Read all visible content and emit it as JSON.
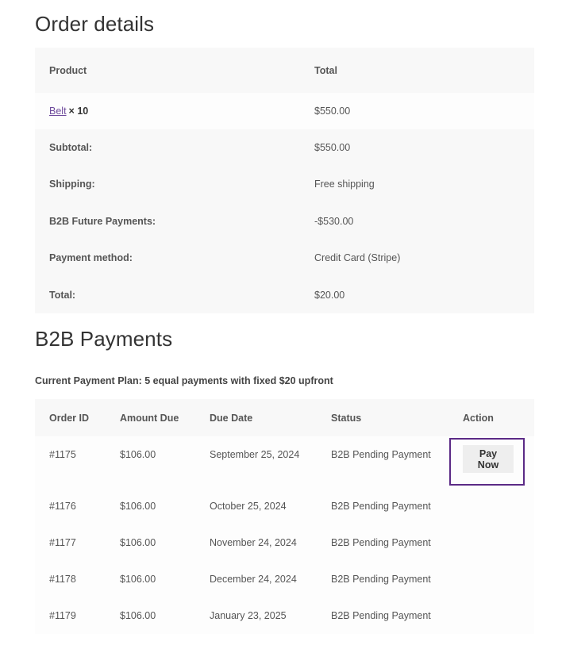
{
  "order_details": {
    "title": "Order details",
    "headers": {
      "product": "Product",
      "total": "Total"
    },
    "product_row": {
      "name": "Belt",
      "qty": "× 10",
      "total": "$550.00"
    },
    "rows": [
      {
        "label": "Subtotal:",
        "value": "$550.00"
      },
      {
        "label": "Shipping:",
        "value": "Free shipping"
      },
      {
        "label": "B2B Future Payments:",
        "value": "-$530.00"
      },
      {
        "label": "Payment method:",
        "value": "Credit Card (Stripe)"
      },
      {
        "label": "Total:",
        "value": "$20.00"
      }
    ]
  },
  "b2b_payments": {
    "title": "B2B Payments",
    "plan": "Current Payment Plan: 5 equal payments with fixed $20 upfront",
    "headers": {
      "order_id": "Order ID",
      "amount_due": "Amount Due",
      "due_date": "Due Date",
      "status": "Status",
      "action": "Action"
    },
    "pay_now_label": "Pay Now",
    "rows": [
      {
        "order_id": "#1175",
        "amount": "$106.00",
        "date": "September 25, 2024",
        "status": "B2B Pending Payment"
      },
      {
        "order_id": "#1176",
        "amount": "$106.00",
        "date": "October 25, 2024",
        "status": "B2B Pending Payment"
      },
      {
        "order_id": "#1177",
        "amount": "$106.00",
        "date": "November 24, 2024",
        "status": "B2B Pending Payment"
      },
      {
        "order_id": "#1178",
        "amount": "$106.00",
        "date": "December 24, 2024",
        "status": "B2B Pending Payment"
      },
      {
        "order_id": "#1179",
        "amount": "$106.00",
        "date": "January 23, 2025",
        "status": "B2B Pending Payment"
      }
    ]
  },
  "colors": {
    "link": "#6e4a9c",
    "highlight_border": "#5b2a86",
    "row_shade": "#f8f8f8",
    "button_bg": "#eeeeee"
  }
}
